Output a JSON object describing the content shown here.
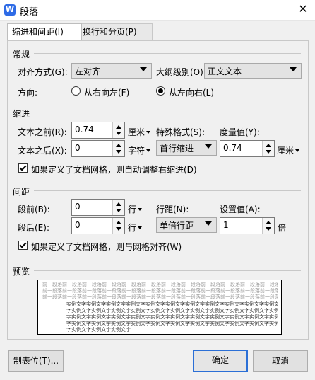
{
  "window": {
    "title": "段落",
    "close": "✕",
    "logo": "W"
  },
  "tabs": [
    {
      "label": "缩进和间距(I)",
      "active": true
    },
    {
      "label": "换行和分页(P)",
      "active": false
    }
  ],
  "general": {
    "section_title": "常规",
    "alignment_label": "对齐方式(G):",
    "alignment_value": "左对齐",
    "outline_label": "大纲级别(O):",
    "outline_value": "正文文本",
    "direction_label": "方向:",
    "rtl_label": "从右向左(F)",
    "ltr_label": "从左向右(L)",
    "direction_selected": "ltr"
  },
  "indent": {
    "section_title": "缩进",
    "before_label": "文本之前(R):",
    "before_value": "0.74",
    "before_unit": "厘米",
    "after_label": "文本之后(X):",
    "after_value": "0",
    "after_unit": "字符",
    "special_label": "特殊格式(S):",
    "special_value": "首行缩进",
    "measure_label": "度量值(Y):",
    "measure_value": "0.74",
    "measure_unit": "厘米",
    "grid_checkbox_label": "如果定义了文档网格，则自动调整右缩进(D)",
    "grid_checkbox_checked": true
  },
  "spacing": {
    "section_title": "间距",
    "before_label": "段前(B):",
    "before_value": "0",
    "before_unit": "行",
    "after_label": "段后(E):",
    "after_value": "0",
    "after_unit": "行",
    "line_spacing_label": "行距(N):",
    "line_spacing_value": "单倍行距",
    "setting_label": "设置值(A):",
    "setting_value": "1",
    "setting_unit": "倍",
    "grid_checkbox_label": "如果定义了文档网格，则与网格对齐(W)",
    "grid_checkbox_checked": true
  },
  "preview": {
    "section_title": "预览",
    "prev_lines": [
      "前一段落前一段落前一段落前一段落前一段落前一段落前一段落前一段落前一段落前一段落前一段落前一段落前一段落",
      "前一段落前一段落前一段落前一段落前一段落前一段落前一段落前一段落前一段落前一段落前一段落前一段落前一段落",
      "前一段落前一段落前一段落前一段落前一段落前一段落前一段落前一段落前一段落前一段落前一段落前一段落前一段落"
    ],
    "cur_lines": [
      "实例文字实例文字实例文字实例文字实例文字实例文字实例文字实例文字实例文字实例文字实例文字实例文字",
      "字实例文字实例文字实例文字实例文字实例文字实例文字实例文字实例文字实例文字实例文字实例文字实例文",
      "字实例文字实例文字实例文字实例文字实例文字实例文字实例文字实例文字实例文字实例文字实例文字实例文",
      "字实例文字实例文字实例文字实例文字实例文字实例文字实例文字实例文字实例文字实例文字实例文字实例文",
      "字实例文字实例文字实例文字"
    ]
  },
  "buttons": {
    "tabs_label": "制表位(T)...",
    "ok_label": "确定",
    "cancel_label": "取消"
  }
}
